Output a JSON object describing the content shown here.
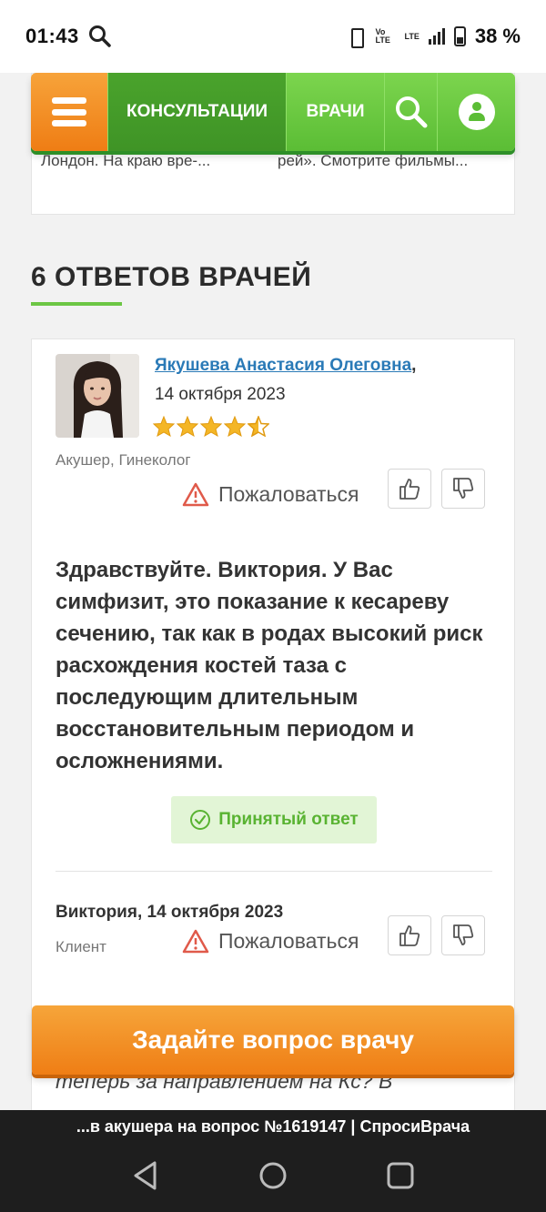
{
  "status_bar": {
    "time": "01:43",
    "network_label": "Vo LTE",
    "network_type": "LTE",
    "battery": "38 %"
  },
  "nav": {
    "consultations": "КОНСУЛЬТАЦИИ",
    "doctors": "ВРАЧИ",
    "icons": [
      "menu-icon",
      "search-icon",
      "user-icon"
    ],
    "colors": {
      "green": "#5bbd35",
      "orange": "#ef7d14"
    }
  },
  "previous_card": {
    "left_text": "Лондон. На краю вре-...",
    "right_text": "рей». Смотрите фильмы..."
  },
  "answers": {
    "title": "6 ОТВЕТОВ ВРАЧЕЙ"
  },
  "answer": {
    "doctor_name": "Якушева Анастасия Олеговна",
    "comma": ",",
    "date": "14 октября 2023",
    "rating": 4.5,
    "specialty": "Акушер, Гинеколог",
    "complain": "Пожаловаться",
    "text": "Здравствуйте. Виктория. У Вас симфизит, это показание к кесареву сечению, так как в родах высокий риск расхождения костей таза с последующим длительным восстановительным периодом и осложнениями.",
    "accepted": "Принятый ответ"
  },
  "client_reply": {
    "author_date": "Виктория, 14 октября 2023",
    "role": "Клиент",
    "complain": "Пожаловаться",
    "text": "теперь за направлением на Кс? В"
  },
  "cta": {
    "ask_doctor": "Задайте вопрос врачу"
  },
  "browser_tab": {
    "title": "...в акушера на вопрос №1619147 | СпросиВрача"
  }
}
